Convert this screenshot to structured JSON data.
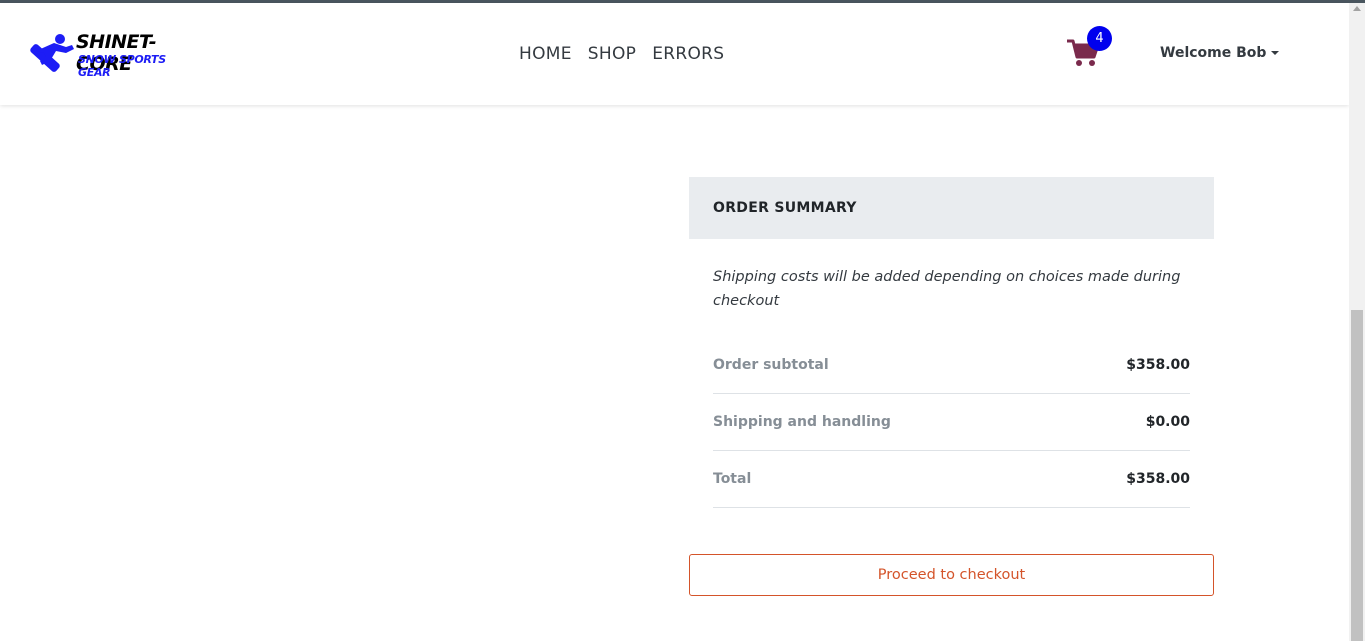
{
  "brand": {
    "title": "SHINET-CORE",
    "subtitle": "SNOW SPORTS GEAR",
    "logo_icon": "snowboarder-icon",
    "accent": "#1d1df5"
  },
  "nav": {
    "items": [
      {
        "label": "HOME"
      },
      {
        "label": "SHOP"
      },
      {
        "label": "ERRORS"
      }
    ]
  },
  "cart": {
    "count": "4",
    "icon": "cart-icon",
    "color": "#7a2a4c",
    "badge_color": "#0000ee"
  },
  "user": {
    "greeting": "Welcome Bob"
  },
  "summary": {
    "header": "ORDER SUMMARY",
    "note": "Shipping costs will be added depending on choices made during checkout",
    "rows": [
      {
        "label": "Order subtotal",
        "value": "$358.00"
      },
      {
        "label": "Shipping and handling",
        "value": "$0.00"
      },
      {
        "label": "Total",
        "value": "$358.00"
      }
    ],
    "checkout_label": "Proceed to checkout",
    "checkout_color": "#d4542a"
  }
}
